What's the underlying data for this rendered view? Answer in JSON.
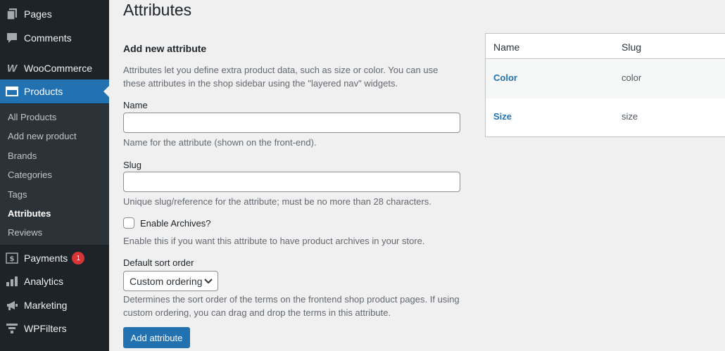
{
  "sidebar": {
    "top_items": [
      {
        "label": "Pages"
      },
      {
        "label": "Comments"
      },
      {
        "label": "WooCommerce"
      },
      {
        "label": "Products"
      }
    ],
    "submenu": [
      {
        "label": "All Products"
      },
      {
        "label": "Add new product"
      },
      {
        "label": "Brands"
      },
      {
        "label": "Categories"
      },
      {
        "label": "Tags"
      },
      {
        "label": "Attributes"
      },
      {
        "label": "Reviews"
      }
    ],
    "bottom_items": [
      {
        "label": "Payments",
        "badge": "1"
      },
      {
        "label": "Analytics"
      },
      {
        "label": "Marketing"
      },
      {
        "label": "WPFilters"
      }
    ]
  },
  "page": {
    "title": "Attributes"
  },
  "form": {
    "heading": "Add new attribute",
    "intro": "Attributes let you define extra product data, such as size or color. You can use these attributes in the shop sidebar using the \"layered nav\" widgets.",
    "name_label": "Name",
    "name_value": "",
    "name_help": "Name for the attribute (shown on the front-end).",
    "slug_label": "Slug",
    "slug_value": "",
    "slug_help": "Unique slug/reference for the attribute; must be no more than 28 characters.",
    "archives_label": "Enable Archives?",
    "archives_help": "Enable this if you want this attribute to have product archives in your store.",
    "sort_label": "Default sort order",
    "sort_value": "Custom ordering",
    "sort_help": "Determines the sort order of the terms on the frontend shop product pages. If using custom ordering, you can drag and drop the terms in this attribute.",
    "submit_label": "Add attribute"
  },
  "table": {
    "headers": {
      "name": "Name",
      "slug": "Slug"
    },
    "rows": [
      {
        "name": "Color",
        "slug": "color"
      },
      {
        "name": "Size",
        "slug": "size"
      }
    ]
  },
  "colors": {
    "sidebar_bg": "#1d2327",
    "accent": "#2271b1",
    "badge": "#d63638"
  }
}
